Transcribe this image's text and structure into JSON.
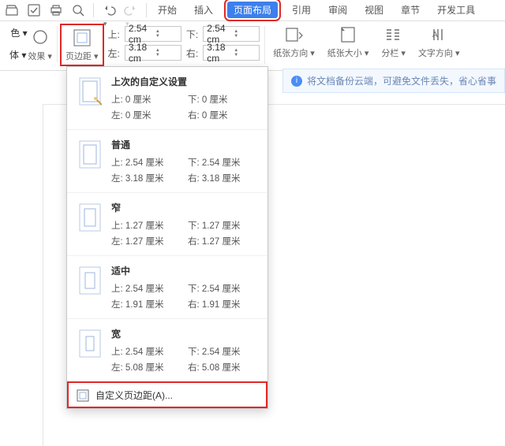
{
  "menubar": [
    "开始",
    "插入",
    "页面布局",
    "引用",
    "审阅",
    "视图",
    "章节",
    "开发工具"
  ],
  "menubar_active_index": 2,
  "ribbon": {
    "font_group_labels": [
      "色 ▾",
      "体 ▾"
    ],
    "effect_label": "效果 ▾",
    "margins_label": "页边距 ▾",
    "inputs": {
      "top_label": "上:",
      "top": "2.54 cm",
      "bottom_label": "下:",
      "bottom": "2.54 cm",
      "left_label": "左:",
      "left": "3.18 cm",
      "right_label": "右:",
      "right": "3.18 cm"
    },
    "right_items": [
      "纸张方向 ▾",
      "纸张大小 ▾",
      "分栏 ▾",
      "文字方向 ▾"
    ]
  },
  "cloud_tip": "将文档备份云端，可避免文件丢失，省心省事",
  "menu": {
    "items": [
      {
        "title": "上次的自定义设置",
        "top": "上: 0 厘米",
        "bottom": "下: 0 厘米",
        "left": "左: 0 厘米",
        "right": "右: 0 厘米",
        "wand": true
      },
      {
        "title": "普通",
        "top": "上: 2.54 厘米",
        "bottom": "下: 2.54 厘米",
        "left": "左: 3.18 厘米",
        "right": "右: 3.18 厘米"
      },
      {
        "title": "窄",
        "top": "上: 1.27 厘米",
        "bottom": "下: 1.27 厘米",
        "left": "左: 1.27 厘米",
        "right": "右: 1.27 厘米"
      },
      {
        "title": "适中",
        "top": "上: 2.54 厘米",
        "bottom": "下: 2.54 厘米",
        "left": "左: 1.91 厘米",
        "right": "右: 1.91 厘米"
      },
      {
        "title": "宽",
        "top": "上: 2.54 厘米",
        "bottom": "下: 2.54 厘米",
        "left": "左: 5.08 厘米",
        "right": "右: 5.08 厘米"
      }
    ],
    "footer": "自定义页边距(A)..."
  }
}
